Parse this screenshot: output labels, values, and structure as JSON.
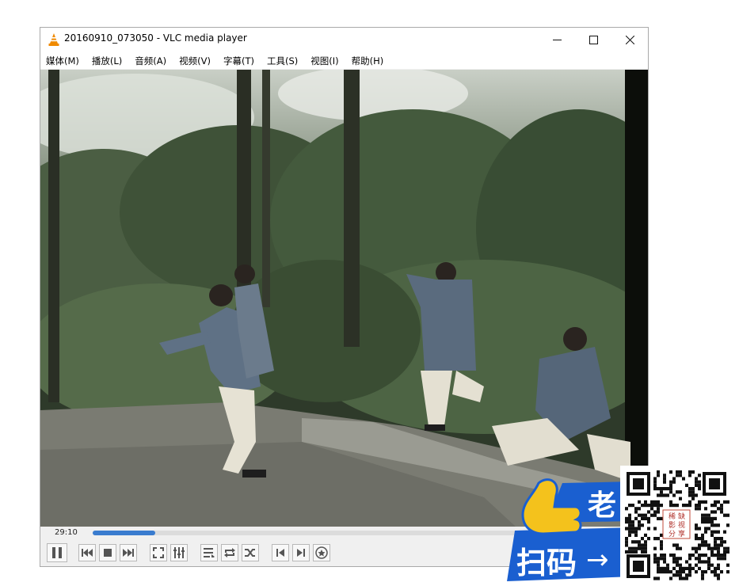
{
  "window": {
    "title": "20160910_073050 - VLC media player",
    "minimize_glyph": "—",
    "maximize_glyph": "☐",
    "close_glyph": "✕"
  },
  "menu": [
    {
      "label": "媒体(M)"
    },
    {
      "label": "播放(L)"
    },
    {
      "label": "音频(A)"
    },
    {
      "label": "视频(V)"
    },
    {
      "label": "字幕(T)"
    },
    {
      "label": "工具(S)"
    },
    {
      "label": "视图(I)"
    },
    {
      "label": "帮助(H)"
    }
  ],
  "playback": {
    "elapsed": "29:10",
    "progress_fraction": 0.115
  },
  "controls": [
    {
      "name": "pause-button",
      "icon": "pause-icon"
    },
    {
      "name": "previous-button",
      "icon": "skip-previous-icon"
    },
    {
      "name": "stop-button",
      "icon": "stop-icon"
    },
    {
      "name": "next-button",
      "icon": "skip-next-icon"
    },
    {
      "name": "fullscreen-button",
      "icon": "fullscreen-icon"
    },
    {
      "name": "extended-settings-button",
      "icon": "equalizer-icon"
    },
    {
      "name": "playlist-button",
      "icon": "playlist-icon"
    },
    {
      "name": "loop-button",
      "icon": "loop-icon"
    },
    {
      "name": "shuffle-button",
      "icon": "shuffle-icon"
    },
    {
      "name": "frame-back-button",
      "icon": "frame-back-icon"
    },
    {
      "name": "frame-forward-button",
      "icon": "frame-forward-icon"
    },
    {
      "name": "snapshot-button",
      "icon": "snapshot-icon"
    }
  ],
  "overlay": {
    "scan_text": "扫码",
    "arrow": "→",
    "partial_text": "老",
    "qr_center_text": [
      "稀",
      "缺",
      "影",
      "视",
      "分",
      "享"
    ]
  },
  "colors": {
    "accent": "#3a7ccf",
    "vlc_cone": "#f08a00",
    "promo_blue": "#1a5fd0",
    "promo_yellow": "#f4c21c"
  }
}
